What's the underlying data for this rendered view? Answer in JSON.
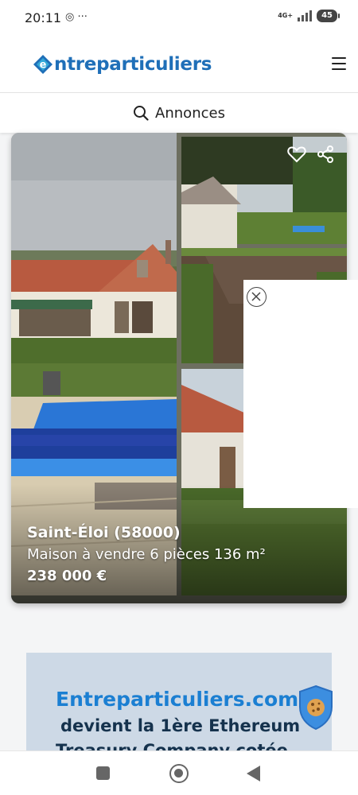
{
  "status_bar": {
    "time": "20:11",
    "icons": "◎ ···",
    "network": "4G+",
    "battery": "45"
  },
  "header": {
    "logo_text": "ntreparticuliers",
    "logo_letter": "e",
    "brand_color": "#1f6fb8",
    "accent_color": "#33a8d8"
  },
  "search": {
    "label": "Annonces"
  },
  "listing": {
    "city": "Saint-Éloi (58000)",
    "description": "Maison à vendre 6 pièces 136 m²",
    "price": "238 000 €"
  },
  "banner": {
    "line1": "Entreparticuliers.com",
    "line2": "devient la 1ère Ethereum",
    "line3": "Treasury Company cotée"
  },
  "icons": {
    "search": "search-icon",
    "menu": "hamburger-menu-icon",
    "favorite": "heart-icon",
    "share": "share-icon",
    "close": "close-icon",
    "cookie": "cookie-icon"
  }
}
